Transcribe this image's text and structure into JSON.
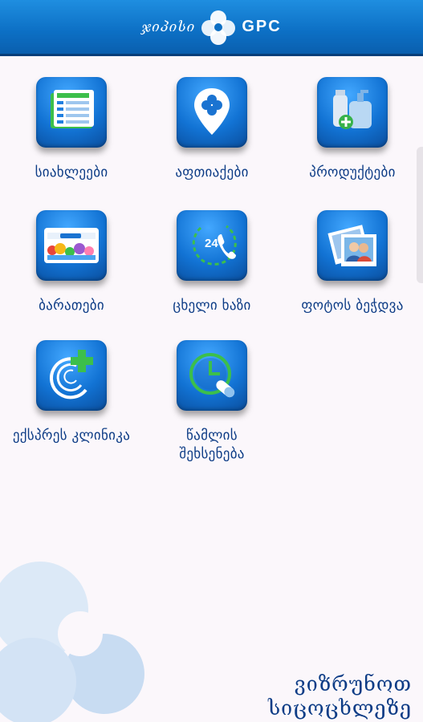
{
  "header": {
    "logo_left": "ჯიპისი",
    "logo_right": "GPC"
  },
  "tiles": [
    {
      "label": "სიახლეები",
      "icon": "news-icon"
    },
    {
      "label": "აფთიაქები",
      "icon": "pharmacy-location-icon"
    },
    {
      "label": "პროდუქტები",
      "icon": "products-icon"
    },
    {
      "label": "ბარათები",
      "icon": "cards-icon"
    },
    {
      "label": "ცხელი ხაზი",
      "icon": "hotline-phone-icon"
    },
    {
      "label": "ფოტოს ბეჭდვა",
      "icon": "photo-print-icon"
    },
    {
      "label": "ექსპრეს კლინიკა",
      "icon": "express-clinic-icon"
    },
    {
      "label": "წამლის შეხსენება",
      "icon": "medicine-reminder-icon"
    }
  ],
  "hotline_number": "24",
  "footer": {
    "slogan_line1": "ვიზრუნოთ",
    "slogan_line2": "სიცოცხლეზე"
  },
  "colors": {
    "header_blue": "#0c6fc4",
    "tile_blue": "#1273d4",
    "label_navy": "#0d3c86",
    "background": "#fbf7fb"
  }
}
